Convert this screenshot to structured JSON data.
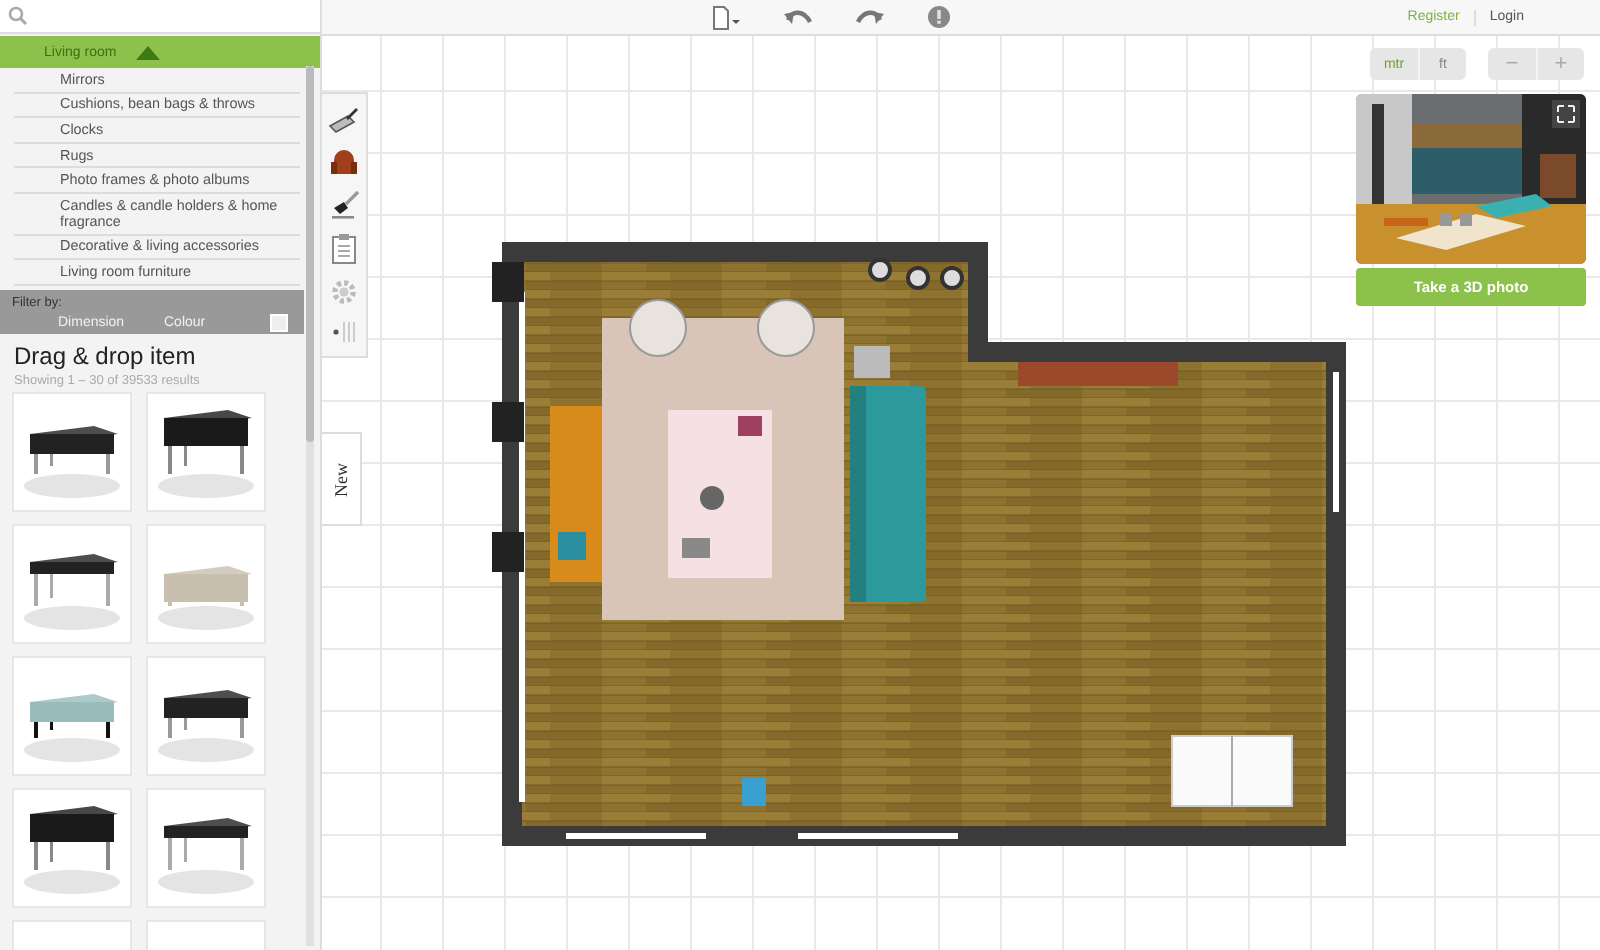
{
  "top_bar": {
    "links": [
      {
        "label": "Register",
        "kind": "accent"
      },
      {
        "label": "Login",
        "kind": "plain"
      }
    ]
  },
  "category_menu": {
    "header": "Living room",
    "expanded": true,
    "items": [
      "Mirrors",
      "Cushions, bean bags & throws",
      "Clocks",
      "Rugs",
      "Photo frames & photo albums",
      "Candles & candle holders & home fragrance",
      "Decorative & living accessories",
      "Living room furniture"
    ]
  },
  "filter": {
    "label": "Filter by:",
    "options": [
      "Dimension",
      "Colour"
    ]
  },
  "catalog": {
    "title": "Drag & drop item",
    "count": "Showing 1 – 30 of 39533 results"
  },
  "side_tab": {
    "label": "New"
  },
  "units": [
    {
      "label": "mtr",
      "selected": true
    },
    {
      "label": "ft",
      "selected": false
    }
  ],
  "zoom_buttons": [
    "−",
    "+"
  ],
  "preview": {
    "button": "Take a 3D photo"
  }
}
